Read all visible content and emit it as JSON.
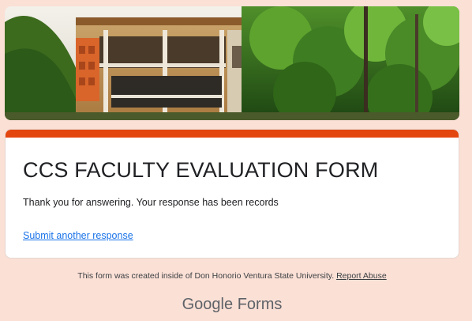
{
  "form": {
    "title": "CCS FACULTY EVALUATION FORM",
    "confirmation": "Thank you for answering. Your response has been records",
    "another_response_label": "Submit another response",
    "accent_color": "#e4460f"
  },
  "footer": {
    "note": "This form was created inside of Don Honorio Ventura State University.",
    "report_abuse_label": "Report Abuse",
    "brand_google": "Google",
    "brand_forms": "Forms"
  },
  "theme": {
    "background": "#fbe0d6",
    "link_color": "#1a73e8"
  },
  "banner": {
    "icon": "building-photo"
  }
}
